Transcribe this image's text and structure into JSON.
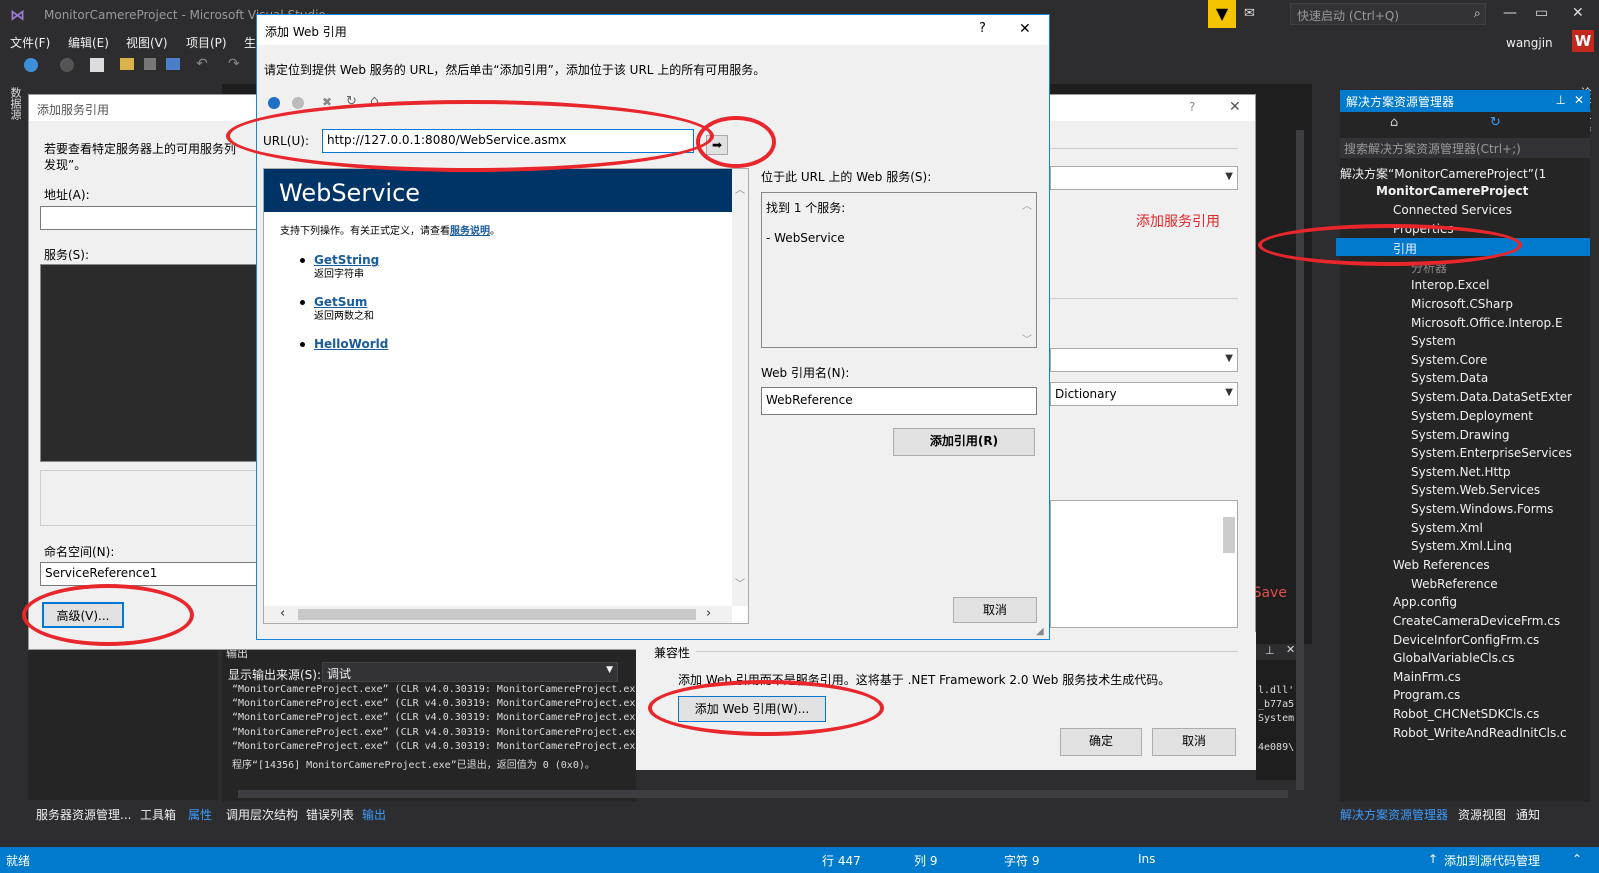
{
  "window_title": "MonitorCamereProject - Microsoft Visual Studio",
  "menu": [
    "文件(F)",
    "编辑(E)",
    "视图(V)",
    "项目(P)",
    "生"
  ],
  "quick_launch_placeholder": "快速启动 (Ctrl+Q)",
  "user": "wangjin",
  "user_initial": "W",
  "left_vertical_tab": "数据源",
  "right_vertical_tab": "诊断工具",
  "service_ref": {
    "title": "添加服务引用",
    "help": "?",
    "intro": "若要查看特定服务器上的可用服务列",
    "intro2": "发现”。",
    "address_label": "地址(A):",
    "services_label": "服务(S):",
    "namespace_label": "命名空间(N):",
    "namespace_value": "ServiceReference1",
    "advanced_button": "高级(V)...",
    "dict_value": "Dictionary",
    "annotation": "添加服务引用",
    "bg_text": "oSave"
  },
  "compat": {
    "title": "兼容性",
    "desc": "添加 Web 引用而不是服务引用。这将基于 .NET Framework 2.0 Web 服务技术生成代码。",
    "add_web_ref_button": "添加 Web 引用(W)...",
    "ok_button": "确定",
    "cancel_button": "取消"
  },
  "web_ref": {
    "title": "添加 Web 引用",
    "help": "?",
    "close": "✕",
    "instruction": "请定位到提供 Web 服务的 URL，然后单击“添加引用”，添加位于该 URL 上的所有可用服务。",
    "url_label": "URL(U):",
    "url_value": "http://127.0.0.1:8080/WebService.asmx",
    "ws_title": "WebService",
    "ws_desc": "支持下列操作。有关正式定义，请查看",
    "ws_desc_link": "服务说明",
    "ws_desc_end": "。",
    "operations": [
      {
        "name": "GetString",
        "desc": "返回字符串"
      },
      {
        "name": "GetSum",
        "desc": "返回两数之和"
      },
      {
        "name": "HelloWorld",
        "desc": ""
      }
    ],
    "services_label": "位于此 URL 上的 Web 服务(S):",
    "found_text": "找到 1 个服务:",
    "found_item": "- WebService",
    "ref_name_label": "Web 引用名(N):",
    "ref_name_value": "WebReference",
    "add_ref_button": "添加引用(R)",
    "cancel_button": "取消"
  },
  "solution_explorer": {
    "title": "解决方案资源管理器",
    "search_placeholder": "搜索解决方案资源管理器(Ctrl+;)",
    "solution": "解决方案“MonitorCamereProject”(1",
    "project": "MonitorCamereProject",
    "items": [
      "Connected Services",
      "Properties",
      "引用",
      "分析器",
      "Interop.Excel",
      "Microsoft.CSharp",
      "Microsoft.Office.Interop.E",
      "System",
      "System.Core",
      "System.Data",
      "System.Data.DataSetExter",
      "System.Deployment",
      "System.Drawing",
      "System.EnterpriseServices",
      "System.Net.Http",
      "System.Web.Services",
      "System.Windows.Forms",
      "System.Xml",
      "System.Xml.Linq",
      "Web References",
      "WebReference",
      "App.config",
      "CreateCameraDeviceFrm.cs",
      "DeviceInforConfigFrm.cs",
      "GlobalVariableCls.cs",
      "MainFrm.cs",
      "Program.cs",
      "Robot_CHCNetSDKCls.cs",
      "Robot_WriteAndReadInitCls.c"
    ],
    "bottom_tabs": [
      "解决方案资源管理器",
      "资源视图",
      "通知"
    ]
  },
  "output": {
    "title": "输出",
    "source_label": "显示输出来源(S):",
    "source_value": "调试",
    "lines": [
      "“MonitorCamereProject.exe” (CLR v4.0.30319: MonitorCamereProject.exe",
      "“MonitorCamereProject.exe” (CLR v4.0.30319: MonitorCamereProject.exe",
      "“MonitorCamereProject.exe” (CLR v4.0.30319: MonitorCamereProject.exe",
      "“MonitorCamereProject.exe” (CLR v4.0.30319: MonitorCamereProject.exe",
      "“MonitorCamereProject.exe” (CLR v4.0.30319: MonitorCamereProject.exe"
    ],
    "exit_line": "程序“[14356] MonitorCamereProject.exe”已退出，返回值为 0 (0x0)。",
    "right_frags": [
      "l.dll'",
      "_b77a5",
      "System",
      "4e089\\"
    ]
  },
  "left_bottom_tabs": [
    "服务器资源管理...",
    "工具箱",
    "属性"
  ],
  "bottom_tabs": [
    "调用层次结构",
    "错误列表",
    "输出"
  ],
  "status": {
    "ready": "就绪",
    "line": "行 447",
    "col": "列 9",
    "char": "字符 9",
    "ins": "Ins",
    "source_control": "添加到源代码管理"
  }
}
